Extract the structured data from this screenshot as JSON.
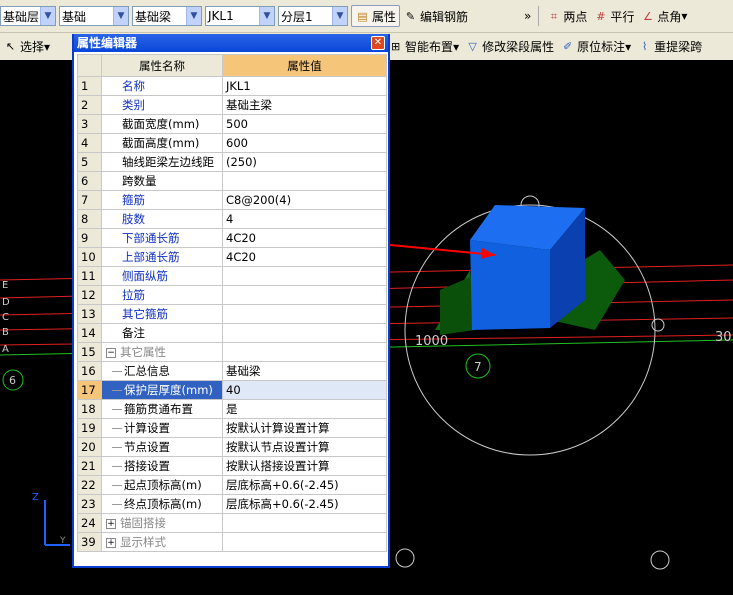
{
  "toolbar1": {
    "combos": [
      "基础层",
      "基础",
      "基础梁",
      "JKL1",
      "分层1"
    ],
    "property_btn": "属性",
    "edit_rebar_btn": "编辑钢筋",
    "more": "»",
    "two_point": "两点",
    "parallel": "平行",
    "point_angle": "点角"
  },
  "toolbar2": {
    "select": "选择",
    "smart_layout": "智能布置",
    "modify_span": "修改梁段属性",
    "in_situ": "原位标注",
    "re_extract": "重提梁跨"
  },
  "dialog": {
    "title": "属性编辑器",
    "col_name": "属性名称",
    "col_value": "属性值",
    "rows": [
      {
        "n": "1",
        "name": "名称",
        "value": "JKL1",
        "style": "blue"
      },
      {
        "n": "2",
        "name": "类别",
        "value": "基础主梁",
        "style": "blue"
      },
      {
        "n": "3",
        "name": "截面宽度(mm)",
        "value": "500",
        "style": ""
      },
      {
        "n": "4",
        "name": "截面高度(mm)",
        "value": "600",
        "style": ""
      },
      {
        "n": "5",
        "name": "轴线距梁左边线距",
        "value": "(250)",
        "style": ""
      },
      {
        "n": "6",
        "name": "跨数量",
        "value": "",
        "style": ""
      },
      {
        "n": "7",
        "name": "箍筋",
        "value": "C8@200(4)",
        "style": "blue"
      },
      {
        "n": "8",
        "name": "肢数",
        "value": "4",
        "style": "blue"
      },
      {
        "n": "9",
        "name": "下部通长筋",
        "value": "4C20",
        "style": "blue"
      },
      {
        "n": "10",
        "name": "上部通长筋",
        "value": "4C20",
        "style": "blue"
      },
      {
        "n": "11",
        "name": "侧面纵筋",
        "value": "",
        "style": "blue"
      },
      {
        "n": "12",
        "name": "拉筋",
        "value": "",
        "style": "blue"
      },
      {
        "n": "13",
        "name": "其它箍筋",
        "value": "",
        "style": "blue"
      },
      {
        "n": "14",
        "name": "备注",
        "value": "",
        "style": ""
      },
      {
        "n": "15",
        "name": "其它属性",
        "value": "",
        "style": "group-open"
      },
      {
        "n": "16",
        "name": "汇总信息",
        "value": "基础梁",
        "style": "child"
      },
      {
        "n": "17",
        "name": "保护层厚度(mm)",
        "value": "40",
        "style": "child sel"
      },
      {
        "n": "18",
        "name": "箍筋贯通布置",
        "value": "是",
        "style": "child"
      },
      {
        "n": "19",
        "name": "计算设置",
        "value": "按默认计算设置计算",
        "style": "child"
      },
      {
        "n": "20",
        "name": "节点设置",
        "value": "按默认节点设置计算",
        "style": "child"
      },
      {
        "n": "21",
        "name": "搭接设置",
        "value": "按默认搭接设置计算",
        "style": "child"
      },
      {
        "n": "22",
        "name": "起点顶标高(m)",
        "value": "层底标高+0.6(-2.45)",
        "style": "child"
      },
      {
        "n": "23",
        "name": "终点顶标高(m)",
        "value": "层底标高+0.6(-2.45)",
        "style": "child"
      },
      {
        "n": "24",
        "name": "锚固搭接",
        "value": "",
        "style": "group-closed"
      },
      {
        "n": "39",
        "name": "显示样式",
        "value": "",
        "style": "group-closed"
      }
    ]
  },
  "canvas": {
    "axis_letters": [
      "E",
      "D",
      "C",
      "B",
      "A"
    ],
    "axis_6": "6",
    "axis_7": "7",
    "dim_1000": "1000",
    "dim_30": "30",
    "z_label": "Z",
    "y_label": "Y"
  },
  "colors": {
    "annotation": "#ff0000",
    "beam": "#1060e0",
    "footing": "#106010"
  }
}
